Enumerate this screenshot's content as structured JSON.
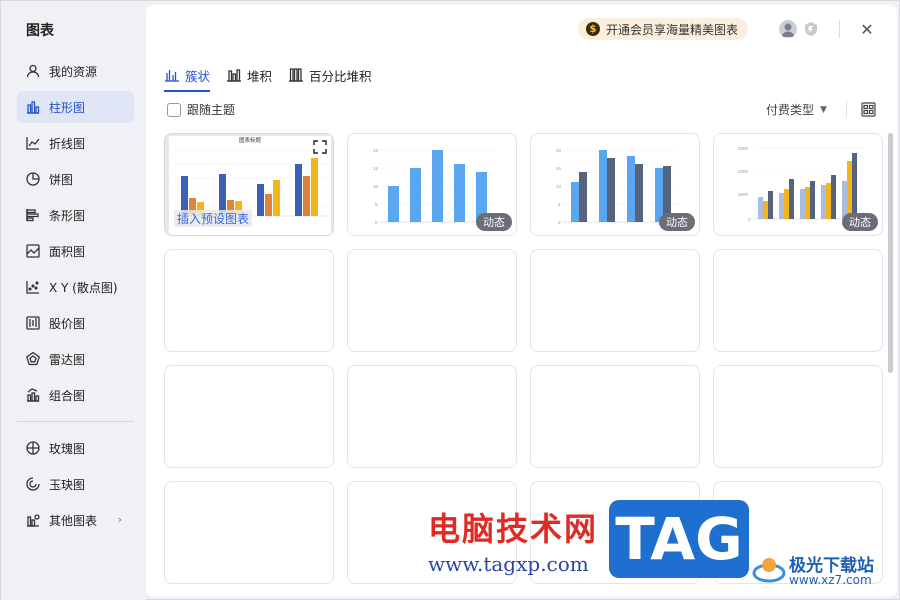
{
  "sidebar": {
    "title": "图表",
    "items": [
      {
        "label": "我的资源",
        "icon": "user-icon"
      },
      {
        "label": "柱形图",
        "icon": "column-chart-icon"
      },
      {
        "label": "折线图",
        "icon": "line-chart-icon"
      },
      {
        "label": "饼图",
        "icon": "pie-chart-icon"
      },
      {
        "label": "条形图",
        "icon": "bar-chart-icon"
      },
      {
        "label": "面积图",
        "icon": "area-chart-icon"
      },
      {
        "label": "X Y (散点图)",
        "icon": "scatter-chart-icon"
      },
      {
        "label": "股价图",
        "icon": "stock-chart-icon"
      },
      {
        "label": "雷达图",
        "icon": "radar-chart-icon"
      },
      {
        "label": "组合图",
        "icon": "combo-chart-icon"
      },
      {
        "label": "玫瑰图",
        "icon": "rose-chart-icon"
      },
      {
        "label": "玉玦图",
        "icon": "ring-chart-icon"
      },
      {
        "label": "其他图表",
        "icon": "other-chart-icon"
      }
    ],
    "active_index": 1
  },
  "header": {
    "promo": "开通会员享海量精美图表",
    "close": "✕"
  },
  "tabs": [
    {
      "label": "簇状",
      "active": true
    },
    {
      "label": "堆积",
      "active": false
    },
    {
      "label": "百分比堆积",
      "active": false
    }
  ],
  "options": {
    "follow_theme": "跟随主题",
    "pay_type": "付费类型"
  },
  "cards": [
    {
      "title": "图表标题",
      "action": "插入预设图表"
    },
    {
      "badge": "动态"
    },
    {
      "badge": "动态"
    },
    {
      "badge": "动态"
    }
  ],
  "watermark": {
    "cn": "电脑技术网",
    "url": "www.tagxp.com",
    "tag": "TAG",
    "site_name": "极光下载站",
    "site_url": "www.xz7.com"
  },
  "colors": {
    "accent": "#2454c9",
    "bar_blue": "#5aa6f0",
    "bar_dark": "#56637d",
    "bar_orange": "#e0823a",
    "bar_yellow": "#f2b51c",
    "bar_navy": "#3d5fb8"
  }
}
